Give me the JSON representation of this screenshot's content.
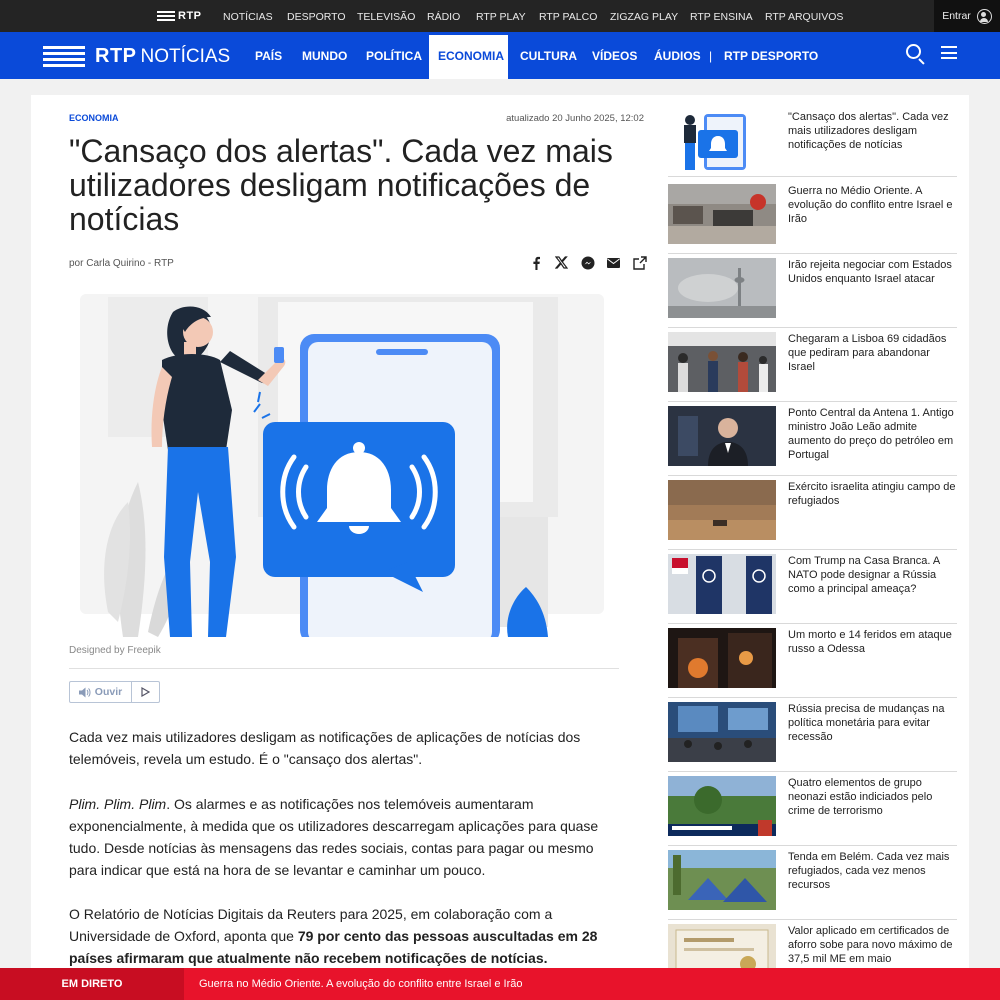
{
  "topbar": {
    "brand": "RTP",
    "links": [
      "NOTÍCIAS",
      "DESPORTO",
      "TELEVISÃO",
      "RÁDIO",
      "RTP PLAY",
      "RTP PALCO",
      "ZIGZAG PLAY",
      "RTP ENSINA",
      "RTP ARQUIVOS"
    ],
    "login_label": "Entrar"
  },
  "header": {
    "logo_rtp": "RTP",
    "logo_section": "NOTÍCIAS",
    "nav": [
      "PAÍS",
      "MUNDO",
      "POLÍTICA",
      "ECONOMIA",
      "CULTURA",
      "VÍDEOS",
      "ÁUDIOS"
    ],
    "active": "ECONOMIA",
    "separator": "|",
    "desporto_prefix": "RTP",
    "desporto_label": "DESPORTO"
  },
  "article": {
    "category": "ECONOMIA",
    "updated": "atualizado 20 Junho 2025, 12:02",
    "title": "\"Cansaço dos alertas\". Cada vez mais utilizadores desligam notificações de notícias",
    "byline": "por Carla Quirino - RTP",
    "image_credit": "Designed by Freepik",
    "listen_label": "Ouvir",
    "p1": "Cada vez mais utilizadores desligam as notificações de aplicações de notícias dos telemóveis, revela um estudo. É o \"cansaço dos alertas\".",
    "p2_italic": "Plim. Plim. Plim",
    "p2_rest": ". Os alarmes e as notificações nos telemóveis aumentaram exponencialmente, à medida que os utilizadores descarregam aplicações para quase tudo. Desde notícias às mensagens das redes sociais, contas para pagar ou mesmo para indicar que está na hora de se levantar e caminhar um pouco.",
    "p3_start": "O Relatório de Notícias Digitais da Reuters para 2025, em colaboração com a Universidade de Oxford, aponta que ",
    "p3_bold": "79 por cento das pessoas auscultadas em 28 países afirmaram que atualmente não recebem notificações de notícias."
  },
  "sidebar": [
    {
      "title": "\"Cansaço dos alertas\". Cada vez mais utilizadores desligam notificações de notícias",
      "thumb": "notification-illustration"
    },
    {
      "title": "Guerra no Médio Oriente. A evolução do conflito entre Israel e Irão",
      "thumb": "destroyed-vehicles"
    },
    {
      "title": "Irão rejeita negociar com Estados Unidos enquanto Israel atacar",
      "thumb": "smoky-city-tower"
    },
    {
      "title": "Chegaram a Lisboa 69 cidadãos que pediram para abandonar Israel",
      "thumb": "airport-crowd"
    },
    {
      "title": "Ponto Central da Antena 1. Antigo ministro João Leão admite aumento do preço do petróleo em Portugal",
      "thumb": "man-in-suit"
    },
    {
      "title": "Exército israelita atingiu campo de refugiados",
      "thumb": "dusty-desert"
    },
    {
      "title": "Com Trump na Casa Branca. A NATO pode designar a Rússia como a principal ameaça?",
      "thumb": "nato-flags"
    },
    {
      "title": "Um morto e 14 feridos em ataque russo a Odessa",
      "thumb": "burning-building"
    },
    {
      "title": "Rússia precisa de mudanças na política monetária para evitar recessão",
      "thumb": "conference-screen"
    },
    {
      "title": "Quatro elementos de grupo neonazi estão indiciados pelo crime de terrorismo",
      "thumb": "tv-news-trees"
    },
    {
      "title": "Tenda em Belém. Cada vez mais refugiados, cada vez menos recursos",
      "thumb": "blue-tents"
    },
    {
      "title": "Valor aplicado em certificados de aforro sobe para novo máximo de 37,5 mil ME em maio",
      "thumb": "certificate-paper"
    }
  ],
  "live": {
    "label": "EM DIRETO",
    "text": "Guerra no Médio Oriente. A evolução do conflito entre Israel e Irão"
  },
  "colors": {
    "brand_blue": "#0a4ad9",
    "live_red": "#e8132b",
    "top_bar": "#242424"
  }
}
